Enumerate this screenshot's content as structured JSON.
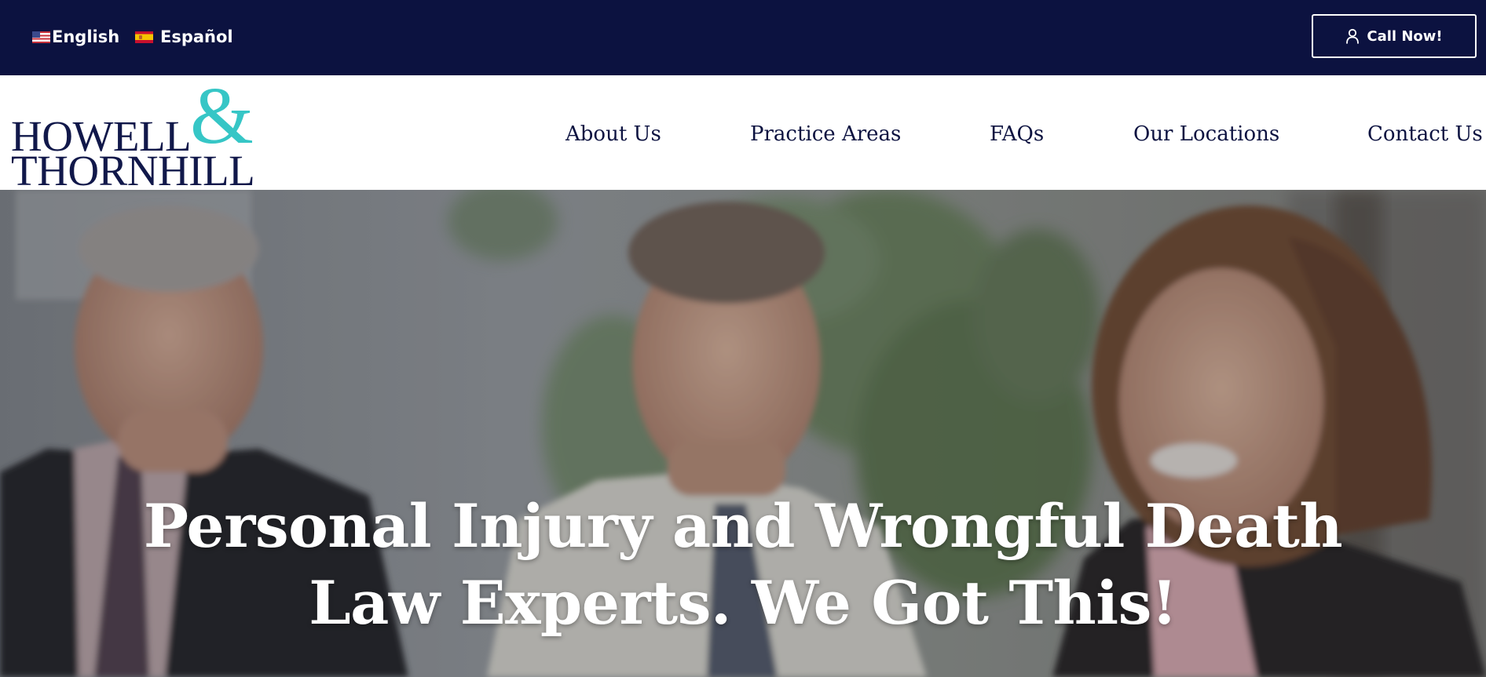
{
  "topbar": {
    "languages": [
      {
        "label": "English",
        "flag": "us-flag-icon"
      },
      {
        "label": "Español",
        "flag": "spain-flag-icon"
      }
    ],
    "call_button": {
      "label": "Call Now!",
      "icon": "user-icon"
    }
  },
  "header": {
    "logo": {
      "line1": "HOWELL",
      "ampersand": "&",
      "line2": "THORNHILL"
    },
    "nav": [
      "About Us",
      "Practice Areas",
      "FAQs",
      "Our Locations",
      "Contact Us"
    ]
  },
  "hero": {
    "heading_line1": "Personal Injury and Wrongful Death",
    "heading_line2": "Law Experts. We Got This!"
  },
  "colors": {
    "topbar_bg": "#0c1240",
    "logo_navy": "#11184a",
    "logo_accent": "#36c6c6",
    "nav_text": "#0c1240"
  }
}
